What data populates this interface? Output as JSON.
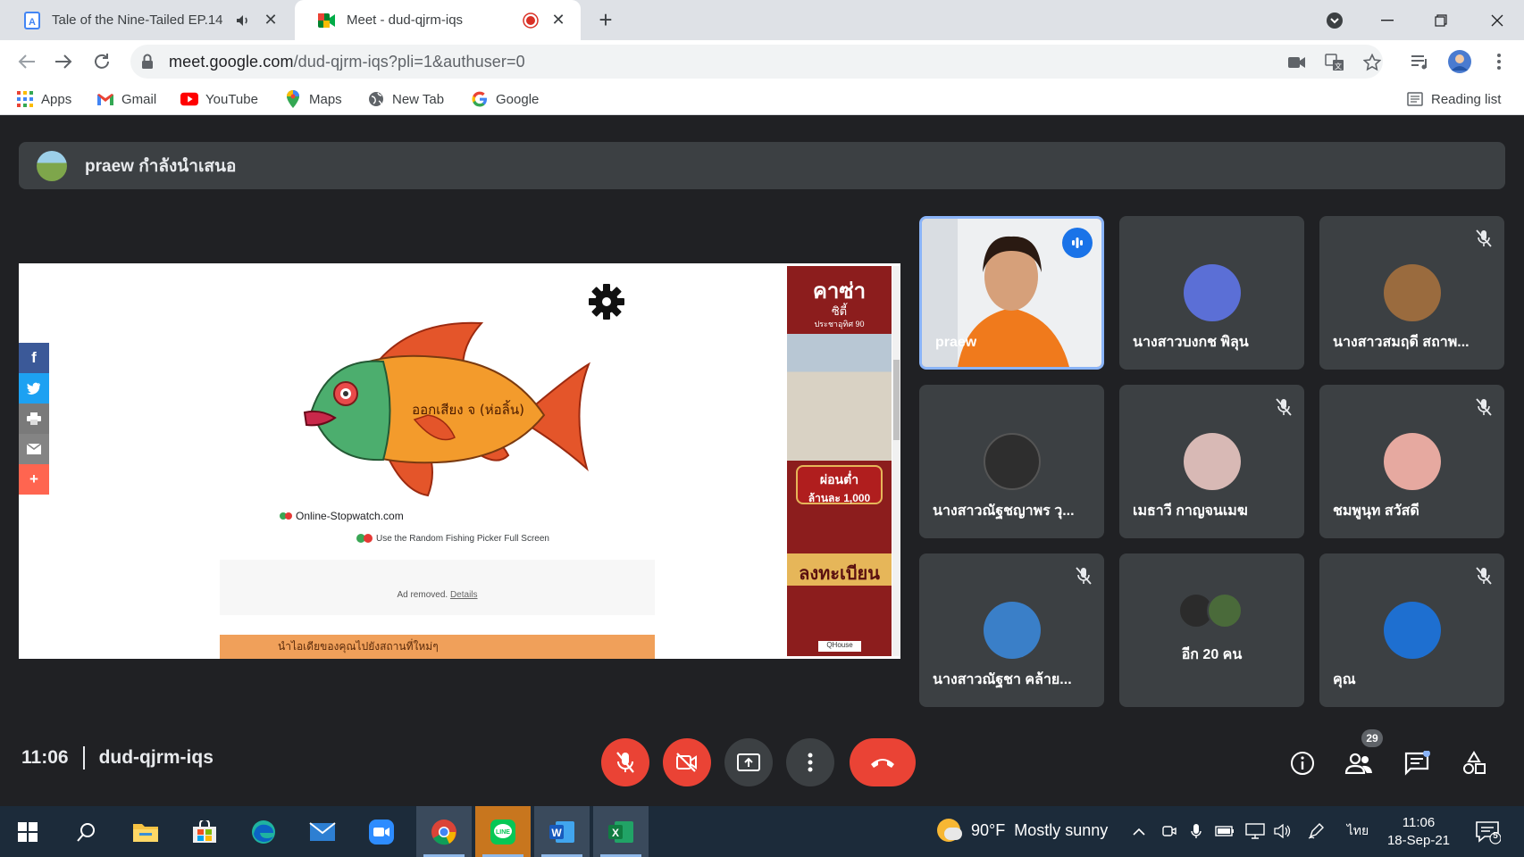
{
  "browser": {
    "tabs": [
      {
        "title": "Tale of the Nine-Tailed EP.14",
        "audio": true,
        "active": false
      },
      {
        "title": "Meet - dud-qjrm-iqs",
        "recording": true,
        "active": true
      }
    ],
    "url_host": "meet.google.com",
    "url_path": "/dud-qjrm-iqs?pli=1&authuser=0",
    "bookmarks": [
      "Apps",
      "Gmail",
      "YouTube",
      "Maps",
      "New Tab",
      "Google"
    ],
    "reading_list": "Reading list"
  },
  "meet": {
    "presenting_text": "praew กำลังนำเสนอ",
    "meeting_code": "dud-qjrm-iqs",
    "time": "11:06",
    "participants_count": "29",
    "tiles": [
      {
        "name": "praew",
        "speaking": true,
        "muted": false,
        "avatar_color": "#e8752c"
      },
      {
        "name": "นางสาวบงกช พิลุน",
        "muted": false,
        "avatar_color": "#5b6fd6"
      },
      {
        "name": "นางสาวสมฤดี สถาพ...",
        "muted": true,
        "avatar_color": "#9a6b3e"
      },
      {
        "name": "นางสาวณัฐชญาพร วุ...",
        "muted": false,
        "avatar_color": "#2e2e2e"
      },
      {
        "name": "เมธาวี กาญจนเมฆ",
        "muted": true,
        "avatar_color": "#d8b9b5"
      },
      {
        "name": "ชมพูนุท สวัสดี",
        "muted": true,
        "avatar_color": "#e6a9a0"
      },
      {
        "name": "นางสาวณัฐชา คล้าย...",
        "muted": true,
        "avatar_color": "#3a7fc8"
      },
      {
        "name": "อีก 20 คน",
        "muted": false,
        "avatar_color": "#444444"
      },
      {
        "name": "คุณ",
        "muted": true,
        "avatar_color": "#1e6fd0"
      }
    ]
  },
  "shared_screen": {
    "fish_text": "ออกเสียง จ (ห่อลิ้น)",
    "site_name": "Online-Stopwatch.com",
    "picker_text": "Use the Random Fishing Picker Full Screen",
    "ad_removed": "Ad removed.",
    "ad_details": "Details",
    "ad_banner_text": "นำไอเดียของคุณไปยังสถานที่ใหม่ๆ",
    "side_ad": {
      "brand": "คาซ่า",
      "sub": "ซิตี้",
      "sub2": "ประชาอุทิศ 90",
      "badge_line1": "ผ่อนต่ำ",
      "badge_line2": "ล้านละ 1,000",
      "cta": "ลงทะเบียน",
      "logo": "QHouse"
    }
  },
  "taskbar": {
    "weather": "90°F  Mostly sunny",
    "lang": "ไทย",
    "time": "11:06",
    "date": "18-Sep-21",
    "notifications": "5"
  }
}
